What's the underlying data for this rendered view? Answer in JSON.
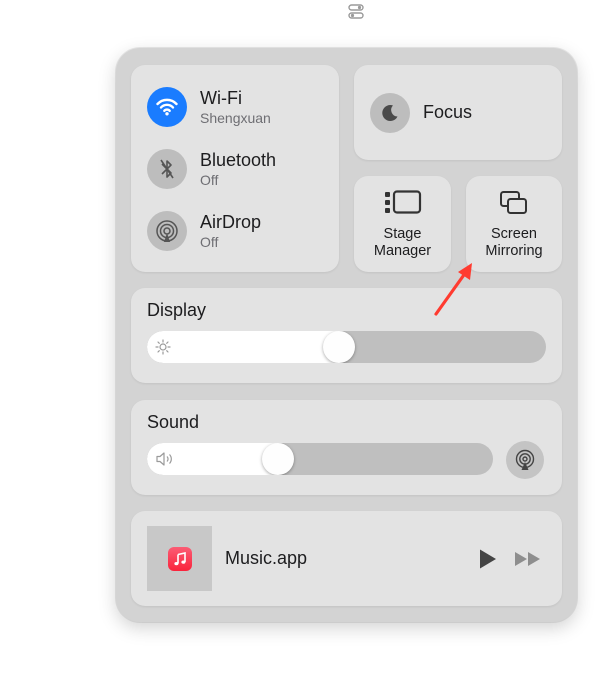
{
  "menubar": {
    "icon": "control-center-icon"
  },
  "connectivity": {
    "wifi": {
      "title": "Wi-Fi",
      "subtitle": "Shengxuan",
      "icon": "wifi-icon",
      "state": "on"
    },
    "bluetooth": {
      "title": "Bluetooth",
      "subtitle": "Off",
      "icon": "bluetooth-icon",
      "state": "off"
    },
    "airdrop": {
      "title": "AirDrop",
      "subtitle": "Off",
      "icon": "airdrop-icon",
      "state": "off"
    }
  },
  "focus": {
    "label": "Focus",
    "icon": "moon-icon"
  },
  "stage_manager": {
    "label": "Stage\nManager",
    "icon": "stage-manager-icon"
  },
  "screen_mirroring": {
    "label": "Screen\nMirroring",
    "icon": "screen-mirroring-icon"
  },
  "display": {
    "label": "Display",
    "brightness": 0.48,
    "icon": "sun-icon"
  },
  "sound": {
    "label": "Sound",
    "volume": 0.38,
    "icon": "speaker-icon",
    "output_icon": "airplay-audio-icon"
  },
  "now_playing": {
    "app": "Music.app",
    "icon": "music-app-icon",
    "play_icon": "play-icon",
    "next_icon": "fast-forward-icon"
  },
  "annotation": {
    "icon": "red-arrow-icon",
    "color": "#ff3b30"
  },
  "colors": {
    "accent": "#1a7cff",
    "panel": "#d3d3d3",
    "tile": "#e3e3e3"
  }
}
